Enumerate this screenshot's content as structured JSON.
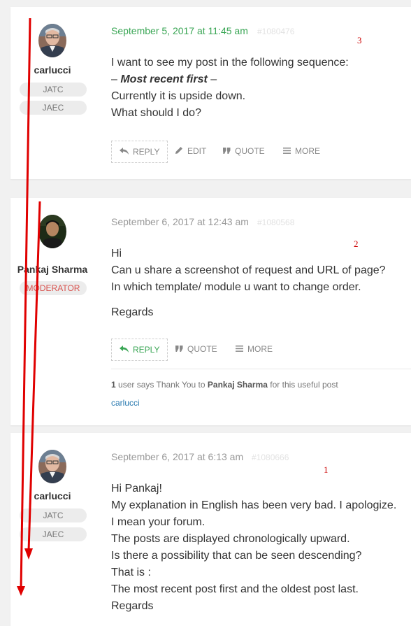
{
  "posts": [
    {
      "author": "carlucci",
      "badges": [
        "JATC",
        "JAEC"
      ],
      "date": "September 5, 2017 at 11:45 am",
      "post_id": "#1080476",
      "marker": "3",
      "content": {
        "line1": "I want to see my post in the following sequence:",
        "line2_pre": "– ",
        "line2_em": "Most recent first",
        "line2_post": " –",
        "line3": "Currently it is upside down.",
        "line4": "What should I do?"
      },
      "actions": {
        "reply": "REPLY",
        "edit": "EDIT",
        "quote": "QUOTE",
        "more": "MORE"
      }
    },
    {
      "author": "Pankaj Sharma",
      "badges": [
        "MODERATOR"
      ],
      "date": "September 6, 2017 at 12:43 am",
      "post_id": "#1080568",
      "marker": "2",
      "content": {
        "line1": "Hi",
        "line2": "Can u share a screenshot of request and URL of page?",
        "line3": "In which template/ module u want to change order.",
        "line4": "Regards"
      },
      "actions": {
        "reply": "REPLY",
        "quote": "QUOTE",
        "more": "MORE"
      },
      "thanks": {
        "count": "1",
        "text_a": " user says Thank You to ",
        "name": "Pankaj Sharma",
        "text_b": " for this useful post",
        "thanker": "carlucci"
      }
    },
    {
      "author": "carlucci",
      "badges": [
        "JATC",
        "JAEC"
      ],
      "date": "September 6, 2017 at 6:13 am",
      "post_id": "#1080666",
      "marker": "1",
      "content": {
        "line1": "Hi Pankaj!",
        "line2": "My explanation in English has been very bad. I apologize.",
        "line3": "I mean your forum.",
        "line4": "The posts are displayed chronologically upward.",
        "line5": "Is there a possibility that can be seen descending?",
        "line6": "That is :",
        "line7": "The most recent post first and the oldest post last.",
        "line8": "Regards"
      }
    }
  ],
  "icons": {
    "reply": "reply-arrow-icon",
    "edit": "pencil-icon",
    "quote": "quote-icon",
    "more": "hamburger-menu-icon"
  },
  "colors": {
    "accent_green": "#3aa655",
    "moderator_red": "#d9534f",
    "annotation_red": "#e00000",
    "link_blue": "#2a7ab0"
  }
}
